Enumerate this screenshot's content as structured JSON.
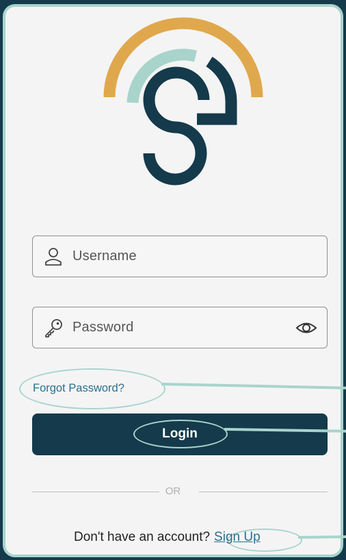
{
  "colors": {
    "background": "#143a4b",
    "card": "#f4f4f4",
    "accent_teal": "#a8d4cc",
    "logo_gold": "#e0a84c",
    "logo_navy": "#143a4b",
    "link": "#2c6e8f"
  },
  "logo": {
    "icon": "s-signal-logo"
  },
  "username": {
    "placeholder": "Username",
    "icon": "user-icon"
  },
  "password": {
    "placeholder": "Password",
    "icon": "key-icon",
    "toggle_icon": "eye-icon"
  },
  "forgot_password": {
    "label": "Forgot Password?"
  },
  "login": {
    "label": "Login"
  },
  "divider": {
    "label": "OR"
  },
  "signup": {
    "prompt": "Don't have an account?",
    "link_label": "Sign Up"
  }
}
